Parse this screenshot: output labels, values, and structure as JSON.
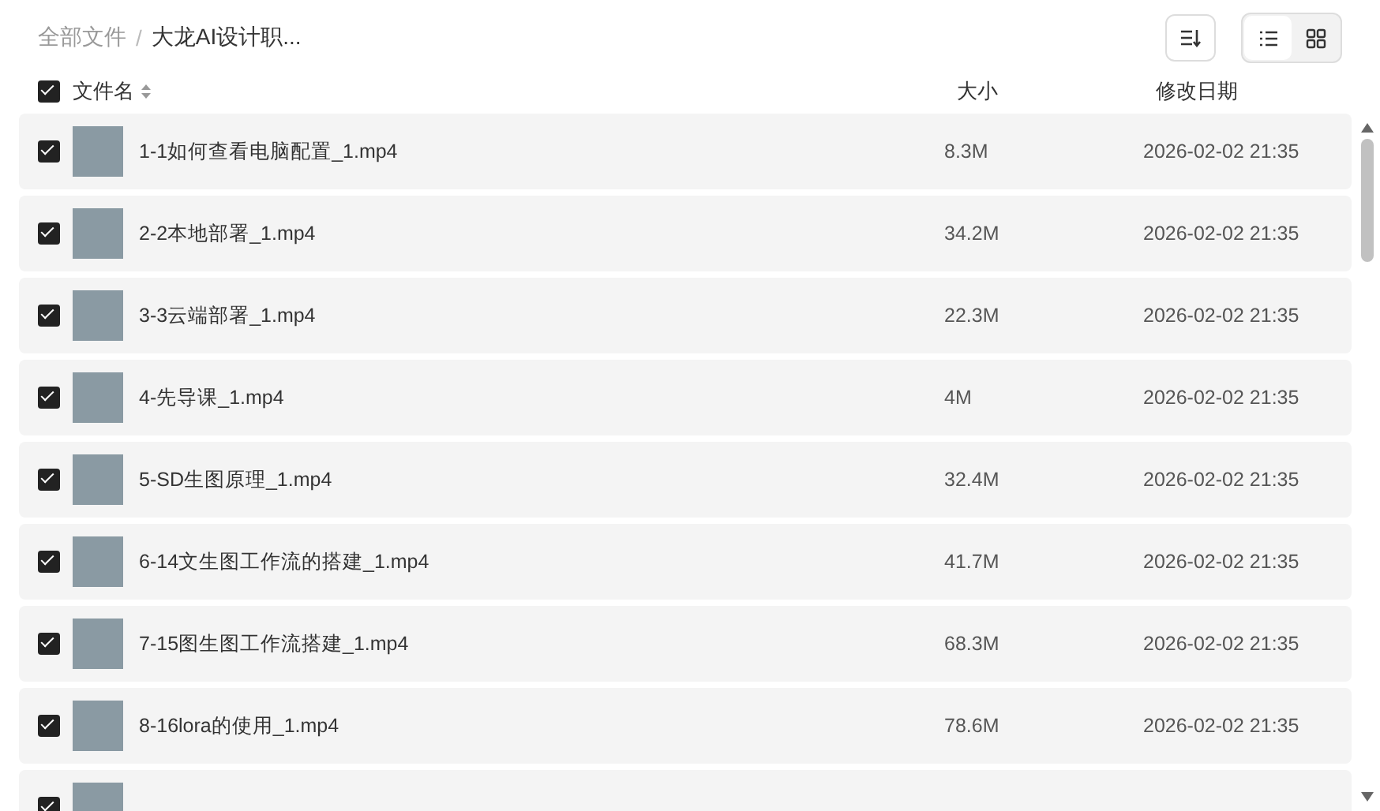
{
  "breadcrumb_separator": "/",
  "breadcrumb": [
    {
      "label": "全部文件",
      "current": false
    },
    {
      "label": "大龙AI设计职...",
      "current": true
    }
  ],
  "view_modes": [
    {
      "kind": "list",
      "selected": true
    },
    {
      "kind": "grid",
      "selected": false
    }
  ],
  "header": {
    "checked": true,
    "columns": [
      "文件名",
      "大小",
      "修改日期"
    ]
  },
  "rows": [
    {
      "checked": true,
      "name": "1-1如何查看电脑配置_1.mp4",
      "size": "8.3M",
      "modified": "2026-02-02 21:35"
    },
    {
      "checked": true,
      "name": "2-2本地部署_1.mp4",
      "size": "34.2M",
      "modified": "2026-02-02 21:35"
    },
    {
      "checked": true,
      "name": "3-3云端部署_1.mp4",
      "size": "22.3M",
      "modified": "2026-02-02 21:35"
    },
    {
      "checked": true,
      "name": "4-先导课_1.mp4",
      "size": "4M",
      "modified": "2026-02-02 21:35"
    },
    {
      "checked": true,
      "name": "5-SD生图原理_1.mp4",
      "size": "32.4M",
      "modified": "2026-02-02 21:35"
    },
    {
      "checked": true,
      "name": "6-14文生图工作流的搭建_1.mp4",
      "size": "41.7M",
      "modified": "2026-02-02 21:35"
    },
    {
      "checked": true,
      "name": "7-15图生图工作流搭建_1.mp4",
      "size": "68.3M",
      "modified": "2026-02-02 21:35"
    },
    {
      "checked": true,
      "name": "8-16lora的使用_1.mp4",
      "size": "78.6M",
      "modified": "2026-02-02 21:35"
    },
    {
      "checked": true
    }
  ]
}
